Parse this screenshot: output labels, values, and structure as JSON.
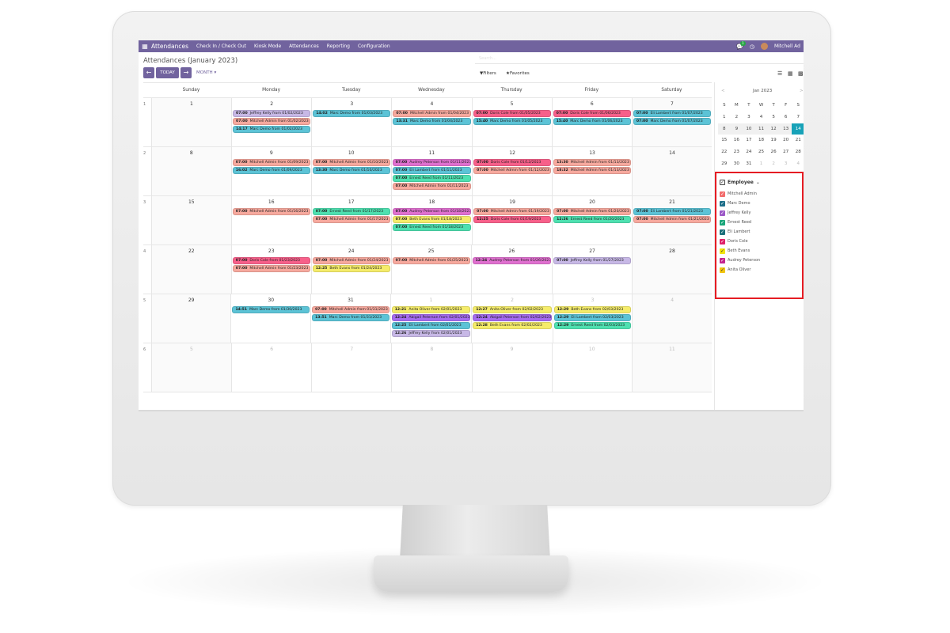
{
  "navbar": {
    "app_title": "Attendances",
    "menu": [
      "Check In / Check Out",
      "Kiosk Mode",
      "Attendances",
      "Reporting",
      "Configuration"
    ],
    "chat_count": "1",
    "user_name": "Mitchell Ad",
    "apps_icon": "grid-icon",
    "chat_icon": "chat-icon",
    "clock_icon": "clock-icon"
  },
  "control_panel": {
    "title": "Attendances (January 2023)",
    "search_placeholder": "Search...",
    "prev_icon": "arrow-left-icon",
    "today_label": "TODAY",
    "next_icon": "arrow-right-icon",
    "scale_label": "MONTH",
    "filters_label": "Filters",
    "favorites_label": "Favorites"
  },
  "calendar": {
    "days": [
      "Sunday",
      "Monday",
      "Tuesday",
      "Wednesday",
      "Thursday",
      "Friday",
      "Saturday"
    ],
    "weeks": [
      {
        "num": "1",
        "days": [
          {
            "d": "1",
            "ev": []
          },
          {
            "d": "2",
            "ev": [
              [
                "07:00",
                "Jeffrey Kelly from 01/02/2023",
                "#c7b8e6"
              ],
              [
                "07:00",
                "Mitchell Admin from 01/02/2023",
                "#f7a99e"
              ],
              [
                "14:17",
                "Marc Demo from 01/02/2023",
                "#5cc3d6"
              ]
            ]
          },
          {
            "d": "3",
            "ev": [
              [
                "14:02",
                "Marc Demo from 01/03/2023",
                "#5cc3d6"
              ]
            ]
          },
          {
            "d": "4",
            "ev": [
              [
                "07:00",
                "Mitchell Admin from 01/04/2023",
                "#f7a99e"
              ],
              [
                "13:31",
                "Marc Demo from 01/04/2023",
                "#5cc3d6"
              ]
            ]
          },
          {
            "d": "5",
            "ev": [
              [
                "07:00",
                "Doris Cole from 01/05/2023",
                "#f7608a"
              ],
              [
                "15:40",
                "Marc Demo from 01/05/2023",
                "#5cc3d6"
              ]
            ]
          },
          {
            "d": "6",
            "ev": [
              [
                "07:00",
                "Doris Cole from 01/06/2023",
                "#f7608a"
              ],
              [
                "15:40",
                "Marc Demo from 01/06/2023",
                "#5cc3d6"
              ]
            ]
          },
          {
            "d": "7",
            "ev": [
              [
                "07:00",
                "Eli Lambert from 01/07/2023",
                "#5cc3d6"
              ],
              [
                "07:00",
                "Marc Demo from 01/07/2023",
                "#5cc3d6"
              ]
            ]
          }
        ]
      },
      {
        "num": "2",
        "days": [
          {
            "d": "8",
            "ev": []
          },
          {
            "d": "9",
            "ev": [
              [
                "07:00",
                "Mitchell Admin from 01/09/2023",
                "#f7a99e"
              ],
              [
                "16:02",
                "Marc Demo from 01/09/2023",
                "#5cc3d6"
              ]
            ]
          },
          {
            "d": "10",
            "ev": [
              [
                "07:00",
                "Mitchell Admin from 01/10/2023",
                "#f7a99e"
              ],
              [
                "13:30",
                "Marc Demo from 01/10/2023",
                "#5cc3d6"
              ]
            ]
          },
          {
            "d": "11",
            "ev": [
              [
                "07:00",
                "Audrey Peterson from 01/11/2023",
                "#e070d0"
              ],
              [
                "07:00",
                "Eli Lambert from 01/11/2023",
                "#5cc3d6"
              ],
              [
                "07:00",
                "Ernest Reed from 01/11/2023",
                "#4ee0b0"
              ],
              [
                "07:00",
                "Mitchell Admin from 01/11/2023",
                "#f7a99e"
              ]
            ]
          },
          {
            "d": "12",
            "ev": [
              [
                "07:00",
                "Doris Cole from 01/12/2023",
                "#f7608a"
              ],
              [
                "07:00",
                "Mitchell Admin from 01/12/2023",
                "#f7a99e"
              ]
            ]
          },
          {
            "d": "13",
            "ev": [
              [
                "13:30",
                "Mitchell Admin from 01/13/2023",
                "#f7a99e"
              ],
              [
                "18:32",
                "Mitchell Admin from 01/13/2023",
                "#f7a99e"
              ]
            ]
          },
          {
            "d": "14",
            "ev": []
          }
        ]
      },
      {
        "num": "3",
        "days": [
          {
            "d": "15",
            "ev": []
          },
          {
            "d": "16",
            "ev": [
              [
                "07:00",
                "Mitchell Admin from 01/16/2023",
                "#f7a99e"
              ]
            ]
          },
          {
            "d": "17",
            "ev": [
              [
                "07:00",
                "Ernest Reed from 01/17/2023",
                "#4ee0b0"
              ],
              [
                "07:00",
                "Mitchell Admin from 01/17/2023",
                "#f7a99e"
              ]
            ]
          },
          {
            "d": "18",
            "ev": [
              [
                "07:00",
                "Audrey Peterson from 01/18/2023",
                "#e070d0"
              ],
              [
                "07:00",
                "Beth Evans from 01/18/2023",
                "#f5ec6a"
              ],
              [
                "07:00",
                "Ernest Reed from 01/18/2023",
                "#4ee0b0"
              ]
            ]
          },
          {
            "d": "19",
            "ev": [
              [
                "07:00",
                "Mitchell Admin from 01/19/2023",
                "#f7a99e"
              ],
              [
                "12:25",
                "Doris Cole from 01/19/2023",
                "#f7608a"
              ]
            ]
          },
          {
            "d": "20",
            "ev": [
              [
                "07:00",
                "Mitchell Admin from 01/20/2023",
                "#f7a99e"
              ],
              [
                "12:26",
                "Ernest Reed from 01/20/2023",
                "#4ee0b0"
              ]
            ]
          },
          {
            "d": "21",
            "ev": [
              [
                "07:00",
                "Eli Lambert from 01/21/2023",
                "#5cc3d6"
              ],
              [
                "07:00",
                "Mitchell Admin from 01/21/2023",
                "#f7a99e"
              ]
            ]
          }
        ]
      },
      {
        "num": "4",
        "days": [
          {
            "d": "22",
            "ev": []
          },
          {
            "d": "23",
            "ev": [
              [
                "07:00",
                "Doris Cole from 01/23/2023",
                "#f7608a"
              ],
              [
                "07:00",
                "Mitchell Admin from 01/23/2023",
                "#f7a99e"
              ]
            ]
          },
          {
            "d": "24",
            "ev": [
              [
                "07:00",
                "Mitchell Admin from 01/24/2023",
                "#f7a99e"
              ],
              [
                "12:25",
                "Beth Evans from 01/24/2023",
                "#f5ec6a"
              ]
            ]
          },
          {
            "d": "25",
            "ev": [
              [
                "07:00",
                "Mitchell Admin from 01/25/2023",
                "#f7a99e"
              ]
            ]
          },
          {
            "d": "26",
            "ev": [
              [
                "12:24",
                "Audrey Peterson from 01/26/2023",
                "#e070d0"
              ]
            ]
          },
          {
            "d": "27",
            "ev": [
              [
                "07:00",
                "Jeffrey Kelly from 01/27/2023",
                "#c7b8e6"
              ]
            ]
          },
          {
            "d": "28",
            "ev": []
          }
        ]
      },
      {
        "num": "5",
        "days": [
          {
            "d": "29",
            "ev": []
          },
          {
            "d": "30",
            "ev": [
              [
                "14:51",
                "Marc Demo from 01/30/2023",
                "#5cc3d6"
              ]
            ]
          },
          {
            "d": "31",
            "ev": [
              [
                "07:00",
                "Mitchell Admin from 01/31/2023",
                "#f7a99e"
              ],
              [
                "13:51",
                "Marc Demo from 01/31/2023",
                "#5cc3d6"
              ]
            ]
          },
          {
            "d": "1",
            "muted": true,
            "ev": [
              [
                "12:21",
                "Anita Oliver from 02/01/2023",
                "#f5ec6a"
              ],
              [
                "12:24",
                "Abigail Peterson from 02/01/2023",
                "#a56cf0"
              ],
              [
                "12:25",
                "Eli Lambert from 02/01/2023",
                "#5cc3d6"
              ],
              [
                "12:26",
                "Jeffrey Kelly from 02/01/2023",
                "#c7b8e6"
              ]
            ]
          },
          {
            "d": "2",
            "muted": true,
            "ev": [
              [
                "12:27",
                "Anita Oliver from 02/02/2023",
                "#f5ec6a"
              ],
              [
                "12:24",
                "Abigail Peterson from 02/02/2023",
                "#a56cf0"
              ],
              [
                "12:28",
                "Beth Evans from 02/02/2023",
                "#f5ec6a"
              ]
            ]
          },
          {
            "d": "3",
            "muted": true,
            "ev": [
              [
                "12:29",
                "Beth Evans from 02/03/2023",
                "#f5ec6a"
              ],
              [
                "12:29",
                "Eli Lambert from 02/03/2023",
                "#5cc3d6"
              ],
              [
                "12:29",
                "Ernest Reed from 02/03/2023",
                "#4ee0b0"
              ]
            ]
          },
          {
            "d": "4",
            "muted": true,
            "ev": []
          }
        ]
      },
      {
        "num": "6",
        "days": [
          {
            "d": "5",
            "muted": true,
            "ev": []
          },
          {
            "d": "6",
            "muted": true,
            "ev": []
          },
          {
            "d": "7",
            "muted": true,
            "ev": []
          },
          {
            "d": "8",
            "muted": true,
            "ev": []
          },
          {
            "d": "9",
            "muted": true,
            "ev": []
          },
          {
            "d": "10",
            "muted": true,
            "ev": []
          },
          {
            "d": "11",
            "muted": true,
            "ev": []
          }
        ]
      }
    ]
  },
  "mini_calendar": {
    "title": "Jan 2023",
    "prev": "<",
    "next": ">",
    "dow": [
      "S",
      "M",
      "T",
      "W",
      "T",
      "F",
      "S"
    ],
    "rows": [
      [
        "1",
        "2",
        "3",
        "4",
        "5",
        "6",
        "7"
      ],
      [
        "8",
        "9",
        "10",
        "11",
        "12",
        "13",
        "14"
      ],
      [
        "15",
        "16",
        "17",
        "18",
        "19",
        "20",
        "21"
      ],
      [
        "22",
        "23",
        "24",
        "25",
        "26",
        "27",
        "28"
      ],
      [
        "29",
        "30",
        "31",
        "1",
        "2",
        "3",
        "4"
      ]
    ],
    "selected": "14"
  },
  "employees": {
    "heading": "Employee",
    "items": [
      {
        "name": "Mitchell Admin",
        "color": "#f26d6d"
      },
      {
        "name": "Marc Demo",
        "color": "#1e6f8a"
      },
      {
        "name": "Jeffrey Kelly",
        "color": "#9c59c7"
      },
      {
        "name": "Ernest Reed",
        "color": "#1aa67a"
      },
      {
        "name": "Eli Lambert",
        "color": "#1a6f7a"
      },
      {
        "name": "Doris Cole",
        "color": "#e0226a"
      },
      {
        "name": "Beth Evans",
        "color": "#f1e40f"
      },
      {
        "name": "Audrey Peterson",
        "color": "#c4238f"
      },
      {
        "name": "Anita Oliver",
        "color": "#f1c40f"
      }
    ]
  }
}
